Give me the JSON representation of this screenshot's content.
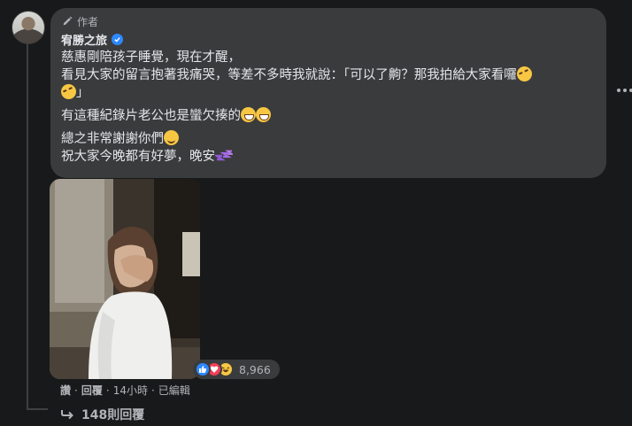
{
  "comment": {
    "author_tag": "作者",
    "author_name": "宥勝之旅",
    "lines": {
      "l1": "慈惠剛陪孩子睡覺，現在才醒，",
      "l2a": "看見大家的留言抱著我痛哭，等差不多時我就說：「可以了齁？那我拍給大家看囉",
      "l2b": "」",
      "l3": "有這種紀錄片老公也是蠻欠揍的",
      "l4": "總之非常謝謝你們",
      "l5": "祝大家今晚都有好夢，晚安"
    },
    "reaction_count": "8,966",
    "reaction_icons": [
      "like-icon",
      "care-icon",
      "haha-icon"
    ],
    "actions": {
      "like": "讚",
      "sep1": "·",
      "reply": "回覆",
      "sep2": "·",
      "time": "14小時",
      "sep3": "·",
      "edited": "已編輯"
    },
    "replies_label": "148則回覆"
  },
  "colors": {
    "background": "#18191a",
    "bubble": "#3a3b3c",
    "text": "#e4e6eb",
    "muted": "#b0b3b8",
    "verified": "#2d88ff"
  }
}
